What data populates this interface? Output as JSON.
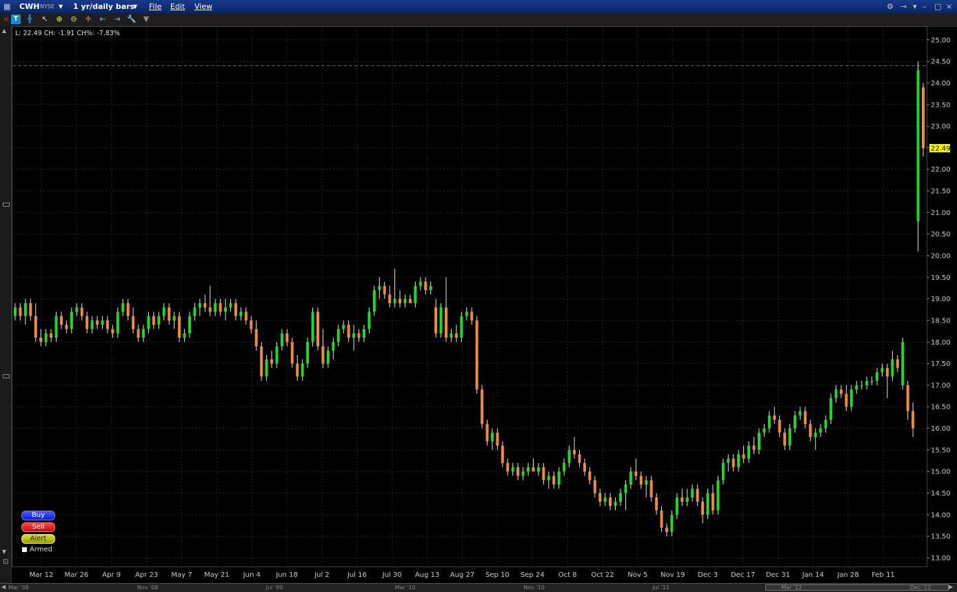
{
  "window": {
    "symbol": "CWH",
    "exchange": "NYSE",
    "period_label": "1 yr/daily bars",
    "menu": [
      "File",
      "Edit",
      "View"
    ]
  },
  "info_line": "L: 22.49  CH: -1.91  CH%: -7.83%",
  "last_price_label": "22.49",
  "order_buttons": {
    "buy": "Buy",
    "sell": "Sell",
    "alert": "Alert",
    "armed": "Armed"
  },
  "colors": {
    "up": "#22d822",
    "down": "#f08a40",
    "background": "#000000",
    "last_price_bg": "#ffff00"
  },
  "scrollbar_labels": [
    "Mar '08",
    "Nov '08",
    "Jul '09",
    "Mar '10",
    "Nov '10",
    "Jul '11",
    "Mar '12",
    "Dec '12"
  ],
  "chart_data": {
    "type": "ohlc",
    "y_ticks": [
      13.0,
      13.5,
      14.0,
      14.5,
      15.0,
      15.5,
      16.0,
      16.5,
      17.0,
      17.5,
      18.0,
      18.5,
      19.0,
      19.5,
      20.0,
      20.5,
      21.0,
      21.5,
      22.0,
      22.5,
      23.0,
      23.5,
      24.0,
      24.5,
      25.0
    ],
    "ylim": [
      12.8,
      25.3
    ],
    "x_ticks": [
      "Mar 12",
      "Mar 26",
      "Apr 9",
      "Apr 23",
      "May 7",
      "May 21",
      "Jun 4",
      "Jun 18",
      "Jul 2",
      "Jul 16",
      "Jul 30",
      "Aug 13",
      "Aug 27",
      "Sep 10",
      "Sep 24",
      "Oct 8",
      "Oct 22",
      "Nov 5",
      "Nov 19",
      "Dec 3",
      "Dec 17",
      "Dec 31",
      "Jan 14",
      "Jan 28",
      "Feb 11"
    ],
    "grid": true,
    "reference_line": 24.4,
    "last_price": 22.49,
    "bars": [
      [
        18.6,
        18.9,
        18.5,
        18.8
      ],
      [
        18.8,
        18.9,
        18.5,
        18.6
      ],
      [
        18.6,
        19.0,
        18.4,
        18.9
      ],
      [
        18.9,
        19.0,
        18.5,
        18.6
      ],
      [
        18.6,
        18.9,
        18.0,
        18.1
      ],
      [
        18.1,
        18.3,
        17.9,
        18.0
      ],
      [
        18.0,
        18.3,
        17.9,
        18.2
      ],
      [
        18.2,
        18.3,
        18.0,
        18.1
      ],
      [
        18.1,
        18.7,
        18.0,
        18.6
      ],
      [
        18.6,
        18.7,
        18.3,
        18.4
      ],
      [
        18.4,
        18.5,
        18.2,
        18.3
      ],
      [
        18.3,
        18.8,
        18.2,
        18.7
      ],
      [
        18.7,
        18.9,
        18.6,
        18.8
      ],
      [
        18.8,
        18.9,
        18.5,
        18.6
      ],
      [
        18.6,
        18.7,
        18.2,
        18.3
      ],
      [
        18.3,
        18.6,
        18.2,
        18.5
      ],
      [
        18.5,
        18.6,
        18.3,
        18.4
      ],
      [
        18.4,
        18.6,
        18.3,
        18.5
      ],
      [
        18.5,
        18.6,
        18.2,
        18.3
      ],
      [
        18.3,
        18.4,
        18.1,
        18.2
      ],
      [
        18.2,
        18.8,
        18.1,
        18.7
      ],
      [
        18.7,
        19.0,
        18.6,
        18.9
      ],
      [
        18.9,
        19.0,
        18.5,
        18.6
      ],
      [
        18.6,
        18.8,
        18.2,
        18.3
      ],
      [
        18.3,
        18.4,
        18.0,
        18.1
      ],
      [
        18.1,
        18.4,
        18.0,
        18.3
      ],
      [
        18.3,
        18.7,
        18.2,
        18.6
      ],
      [
        18.6,
        18.7,
        18.3,
        18.4
      ],
      [
        18.4,
        18.7,
        18.3,
        18.6
      ],
      [
        18.6,
        18.9,
        18.5,
        18.8
      ],
      [
        18.8,
        18.9,
        18.4,
        18.5
      ],
      [
        18.5,
        18.7,
        18.3,
        18.6
      ],
      [
        18.6,
        18.7,
        18.0,
        18.1
      ],
      [
        18.1,
        18.3,
        18.0,
        18.2
      ],
      [
        18.2,
        18.7,
        18.1,
        18.6
      ],
      [
        18.6,
        18.9,
        18.5,
        18.8
      ],
      [
        18.8,
        19.0,
        18.6,
        18.9
      ],
      [
        18.9,
        19.1,
        18.7,
        18.8
      ],
      [
        18.8,
        19.3,
        18.6,
        18.7
      ],
      [
        18.7,
        19.0,
        18.6,
        18.9
      ],
      [
        18.9,
        19.0,
        18.6,
        18.7
      ],
      [
        18.7,
        19.0,
        18.5,
        18.8
      ],
      [
        18.8,
        19.0,
        18.7,
        18.9
      ],
      [
        18.9,
        19.0,
        18.5,
        18.6
      ],
      [
        18.6,
        18.8,
        18.5,
        18.7
      ],
      [
        18.7,
        18.8,
        18.4,
        18.5
      ],
      [
        18.5,
        18.6,
        18.2,
        18.3
      ],
      [
        18.3,
        18.5,
        17.8,
        17.9
      ],
      [
        17.9,
        18.0,
        17.1,
        17.2
      ],
      [
        17.2,
        17.7,
        17.1,
        17.6
      ],
      [
        17.6,
        17.8,
        17.4,
        17.5
      ],
      [
        17.5,
        18.0,
        17.4,
        17.9
      ],
      [
        17.9,
        18.3,
        17.8,
        18.2
      ],
      [
        18.2,
        18.3,
        17.9,
        18.0
      ],
      [
        18.0,
        18.1,
        17.4,
        17.5
      ],
      [
        17.5,
        17.7,
        17.1,
        17.2
      ],
      [
        17.2,
        17.6,
        17.1,
        17.5
      ],
      [
        17.5,
        18.1,
        17.4,
        18.0
      ],
      [
        18.0,
        18.8,
        17.9,
        18.7
      ],
      [
        18.7,
        18.8,
        17.8,
        17.9
      ],
      [
        17.9,
        18.3,
        17.4,
        17.5
      ],
      [
        17.5,
        17.9,
        17.4,
        17.8
      ],
      [
        17.8,
        18.1,
        17.6,
        18.0
      ],
      [
        18.0,
        18.4,
        17.9,
        18.3
      ],
      [
        18.3,
        18.5,
        18.2,
        18.4
      ],
      [
        18.4,
        18.5,
        18.0,
        18.1
      ],
      [
        18.1,
        18.4,
        17.8,
        18.2
      ],
      [
        18.2,
        18.3,
        18.0,
        18.1
      ],
      [
        18.1,
        18.4,
        18.0,
        18.3
      ],
      [
        18.3,
        18.8,
        18.2,
        18.7
      ],
      [
        18.7,
        19.3,
        18.6,
        19.2
      ],
      [
        19.2,
        19.5,
        19.0,
        19.3
      ],
      [
        19.3,
        19.4,
        19.0,
        19.1
      ],
      [
        19.1,
        19.3,
        18.8,
        18.9
      ],
      [
        18.9,
        19.7,
        18.8,
        19.0
      ],
      [
        19.0,
        19.2,
        18.8,
        18.9
      ],
      [
        18.9,
        19.1,
        18.8,
        19.0
      ],
      [
        19.0,
        19.1,
        18.9,
        18.9
      ],
      [
        18.9,
        19.4,
        18.8,
        19.3
      ],
      [
        19.3,
        19.5,
        19.2,
        19.4
      ],
      [
        19.4,
        19.5,
        19.1,
        19.2
      ],
      [
        19.2,
        19.4,
        19.1,
        19.3
      ],
      [
        18.8,
        19.0,
        18.1,
        18.2
      ],
      [
        18.2,
        18.9,
        18.1,
        18.8
      ],
      [
        18.8,
        19.5,
        18.0,
        18.1
      ],
      [
        18.1,
        18.3,
        18.0,
        18.2
      ],
      [
        18.2,
        18.4,
        18.0,
        18.1
      ],
      [
        18.1,
        18.7,
        18.0,
        18.6
      ],
      [
        18.6,
        18.8,
        18.5,
        18.7
      ],
      [
        18.7,
        18.8,
        18.4,
        18.5
      ],
      [
        18.5,
        18.6,
        16.8,
        16.9
      ],
      [
        16.9,
        17.0,
        16.0,
        16.1
      ],
      [
        16.1,
        16.2,
        15.6,
        15.7
      ],
      [
        15.7,
        16.0,
        15.5,
        15.9
      ],
      [
        15.9,
        16.0,
        15.5,
        15.6
      ],
      [
        15.6,
        15.7,
        15.1,
        15.2
      ],
      [
        15.2,
        15.3,
        14.9,
        15.0
      ],
      [
        15.0,
        15.2,
        14.9,
        15.1
      ],
      [
        15.1,
        15.2,
        14.8,
        14.9
      ],
      [
        14.9,
        15.1,
        14.8,
        15.0
      ],
      [
        15.0,
        15.2,
        14.9,
        15.1
      ],
      [
        15.1,
        15.3,
        15.0,
        15.0
      ],
      [
        15.0,
        15.2,
        14.9,
        15.1
      ],
      [
        15.1,
        15.2,
        14.7,
        14.8
      ],
      [
        14.8,
        15.0,
        14.6,
        14.9
      ],
      [
        14.9,
        15.0,
        14.6,
        14.7
      ],
      [
        14.7,
        15.1,
        14.6,
        15.0
      ],
      [
        15.0,
        15.3,
        14.9,
        15.2
      ],
      [
        15.2,
        15.6,
        15.1,
        15.5
      ],
      [
        15.5,
        15.8,
        15.3,
        15.4
      ],
      [
        15.4,
        15.5,
        15.1,
        15.2
      ],
      [
        15.2,
        15.3,
        14.9,
        15.0
      ],
      [
        15.0,
        15.1,
        14.7,
        14.8
      ],
      [
        14.8,
        14.9,
        14.4,
        14.5
      ],
      [
        14.5,
        14.6,
        14.2,
        14.3
      ],
      [
        14.3,
        14.5,
        14.2,
        14.4
      ],
      [
        14.4,
        14.5,
        14.1,
        14.2
      ],
      [
        14.2,
        14.4,
        14.1,
        14.3
      ],
      [
        14.3,
        14.6,
        14.2,
        14.5
      ],
      [
        14.5,
        14.8,
        14.1,
        14.7
      ],
      [
        14.7,
        15.1,
        14.6,
        15.0
      ],
      [
        15.0,
        15.3,
        14.8,
        14.9
      ],
      [
        14.9,
        15.0,
        14.6,
        14.7
      ],
      [
        14.7,
        14.9,
        14.4,
        14.8
      ],
      [
        14.8,
        14.9,
        14.3,
        14.4
      ],
      [
        14.4,
        14.5,
        14.0,
        14.1
      ],
      [
        14.1,
        14.2,
        13.6,
        13.7
      ],
      [
        13.7,
        13.8,
        13.5,
        13.6
      ],
      [
        13.6,
        14.1,
        13.5,
        14.0
      ],
      [
        14.0,
        14.5,
        13.9,
        14.4
      ],
      [
        14.4,
        14.6,
        14.2,
        14.3
      ],
      [
        14.3,
        14.6,
        14.2,
        14.4
      ],
      [
        14.4,
        14.7,
        14.3,
        14.6
      ],
      [
        14.6,
        14.7,
        14.2,
        14.3
      ],
      [
        14.3,
        14.4,
        13.8,
        14.0
      ],
      [
        14.0,
        14.6,
        13.9,
        14.5
      ],
      [
        14.5,
        14.7,
        14.0,
        14.1
      ],
      [
        14.1,
        14.9,
        14.0,
        14.8
      ],
      [
        14.8,
        15.3,
        14.7,
        15.2
      ],
      [
        15.2,
        15.4,
        15.0,
        15.3
      ],
      [
        15.3,
        15.4,
        15.0,
        15.1
      ],
      [
        15.1,
        15.5,
        15.0,
        15.4
      ],
      [
        15.4,
        15.6,
        15.2,
        15.3
      ],
      [
        15.3,
        15.7,
        15.2,
        15.6
      ],
      [
        15.6,
        15.8,
        15.4,
        15.5
      ],
      [
        15.5,
        16.0,
        15.4,
        15.9
      ],
      [
        15.9,
        16.1,
        15.8,
        16.0
      ],
      [
        16.0,
        16.4,
        15.9,
        16.3
      ],
      [
        16.3,
        16.5,
        16.1,
        16.2
      ],
      [
        16.2,
        16.3,
        15.8,
        15.9
      ],
      [
        15.9,
        16.0,
        15.5,
        15.6
      ],
      [
        15.6,
        16.1,
        15.5,
        16.0
      ],
      [
        16.0,
        16.4,
        15.9,
        16.3
      ],
      [
        16.3,
        16.5,
        16.2,
        16.4
      ],
      [
        16.4,
        16.5,
        16.0,
        16.1
      ],
      [
        16.1,
        16.2,
        15.7,
        15.8
      ],
      [
        15.8,
        16.0,
        15.5,
        15.9
      ],
      [
        15.9,
        16.1,
        15.8,
        16.0
      ],
      [
        16.0,
        16.3,
        15.9,
        16.2
      ],
      [
        16.2,
        16.8,
        16.1,
        16.7
      ],
      [
        16.7,
        17.0,
        16.6,
        16.9
      ],
      [
        16.9,
        17.0,
        16.7,
        16.8
      ],
      [
        16.8,
        17.0,
        16.4,
        16.5
      ],
      [
        16.5,
        17.0,
        16.4,
        16.9
      ],
      [
        16.9,
        17.1,
        16.8,
        17.0
      ],
      [
        17.0,
        17.1,
        16.9,
        17.0
      ],
      [
        17.0,
        17.2,
        16.9,
        17.1
      ],
      [
        17.1,
        17.2,
        17.0,
        17.1
      ],
      [
        17.1,
        17.4,
        17.0,
        17.3
      ],
      [
        17.3,
        17.5,
        17.2,
        17.4
      ],
      [
        17.4,
        17.5,
        16.7,
        17.2
      ],
      [
        17.2,
        17.8,
        17.1,
        17.6
      ],
      [
        17.6,
        17.7,
        17.3,
        17.4
      ],
      [
        17.0,
        18.1,
        16.9,
        18.0
      ],
      [
        17.0,
        17.1,
        16.2,
        16.4
      ],
      [
        16.4,
        16.6,
        15.8,
        16.0
      ],
      [
        20.8,
        24.5,
        20.1,
        24.3
      ],
      [
        23.9,
        24.0,
        22.3,
        22.49
      ]
    ]
  }
}
